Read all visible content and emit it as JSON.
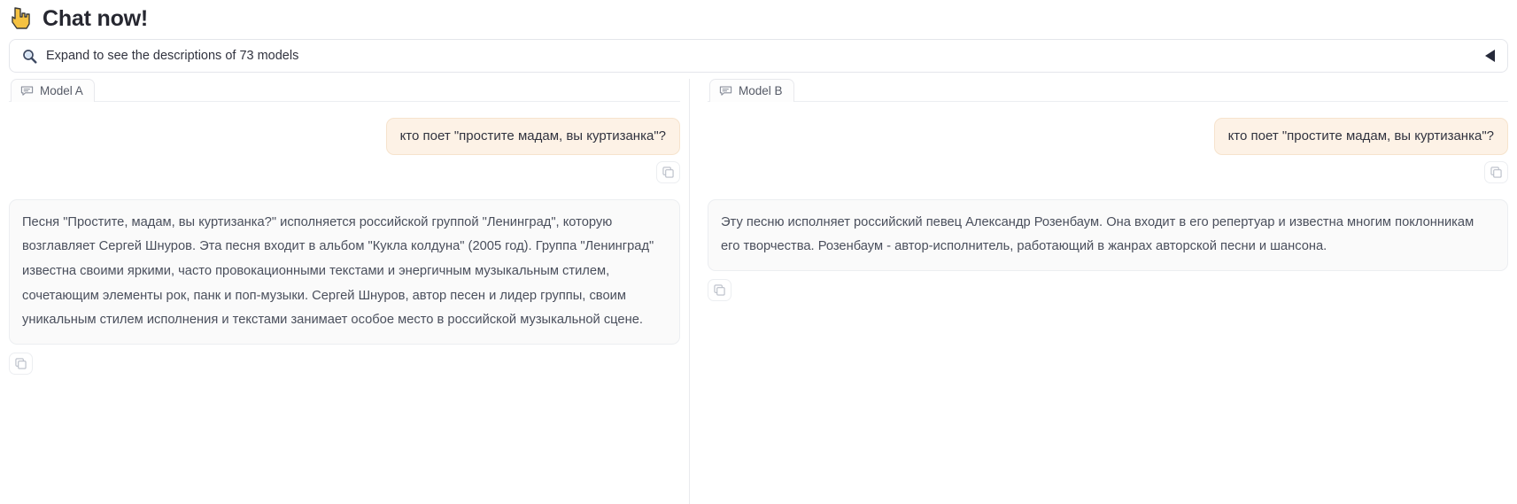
{
  "header": {
    "title": "Chat now!",
    "icon": "pointing-hand-icon"
  },
  "expander": {
    "label": "Expand to see the descriptions of 73 models",
    "search_icon": "search-icon",
    "collapse_icon": "collapse-left-triangle-icon",
    "model_count": "73"
  },
  "colors": {
    "user_bubble_bg": "#fdf2e6",
    "user_bubble_border": "#f6e3cd",
    "assistant_bubble_bg": "#fafafa",
    "assistant_bubble_border": "#eceef1",
    "title_text": "#262730",
    "body_text": "#4a4f5c",
    "collapse_arrow": "#262a3a"
  },
  "panels": [
    {
      "tab_label": "Model A",
      "tab_icon": "chat-bubble-icon",
      "messages": [
        {
          "role": "user",
          "text": "кто поет \"простите мадам, вы куртизанка\"?",
          "copy_label": "copy-icon"
        },
        {
          "role": "assistant",
          "text": "Песня \"Простите, мадам, вы куртизанка?\" исполняется российской группой \"Ленинград\", которую возглавляет Сергей Шнуров. Эта песня входит в альбом \"Кукла колдуна\" (2005 год). Группа \"Ленинград\" известна своими яркими, часто провокационными текстами и энергичным музыкальным стилем, сочетающим элементы рок, панк и поп-музыки. Сергей Шнуров, автор песен и лидер группы, своим уникальным стилем исполнения и текстами занимает особое место в российской музыкальной сцене.",
          "copy_label": "copy-icon"
        }
      ]
    },
    {
      "tab_label": "Model B",
      "tab_icon": "chat-bubble-icon",
      "messages": [
        {
          "role": "user",
          "text": "кто поет \"простите мадам, вы куртизанка\"?",
          "copy_label": "copy-icon"
        },
        {
          "role": "assistant",
          "text": "Эту песню исполняет российский певец Александр Розенбаум. Она входит в его репертуар и известна многим поклонникам его творчества. Розенбаум - автор-исполнитель, работающий в жанрах авторской песни и шансона.",
          "copy_label": "copy-icon"
        }
      ]
    }
  ]
}
